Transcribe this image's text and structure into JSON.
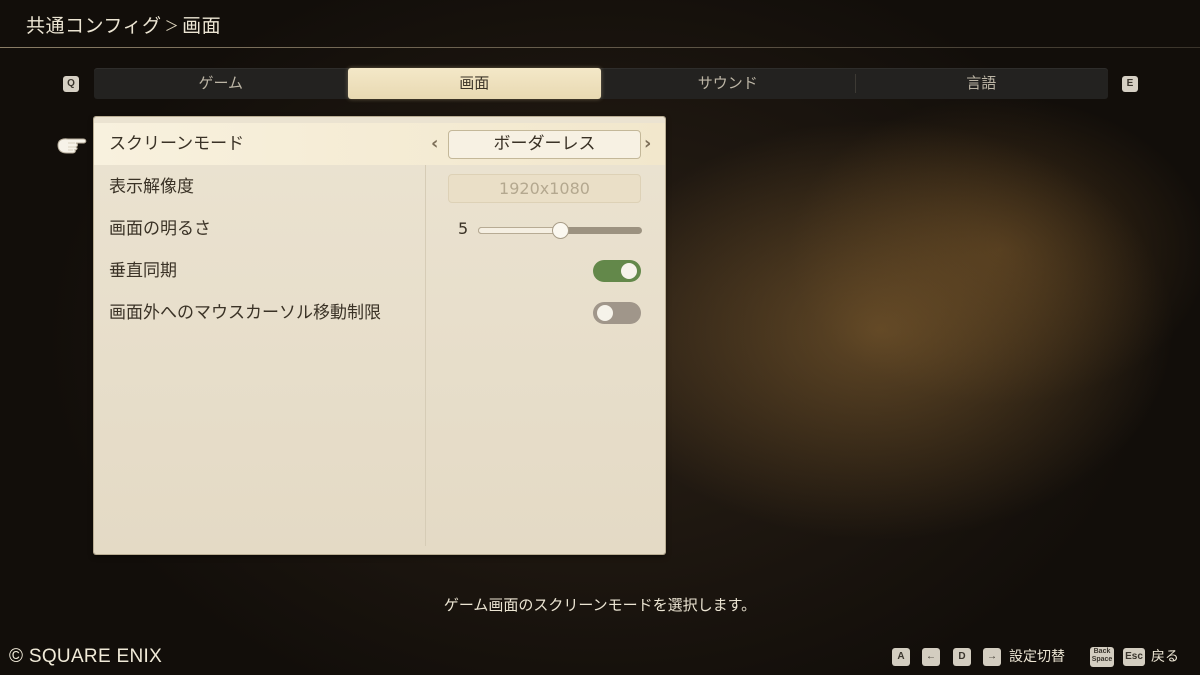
{
  "header": {
    "breadcrumb_root": "共通コンフィグ",
    "breadcrumb_separator": "＞",
    "breadcrumb_current": "画面"
  },
  "tabs": {
    "prev_key": "Q",
    "next_key": "E",
    "items": [
      {
        "label": "ゲーム",
        "active": false
      },
      {
        "label": "画面",
        "active": true
      },
      {
        "label": "サウンド",
        "active": false
      },
      {
        "label": "言語",
        "active": false
      }
    ]
  },
  "settings": {
    "screen_mode": {
      "label": "スクリーンモード",
      "value": "ボーダーレス",
      "left_arrow": "‹",
      "right_arrow": "›"
    },
    "resolution": {
      "label": "表示解像度",
      "value": "1920x1080",
      "disabled": true
    },
    "brightness": {
      "label": "画面の明るさ",
      "value": "5",
      "level_fraction": 0.5
    },
    "vsync": {
      "label": "垂直同期",
      "enabled": true
    },
    "mouse_cursor_limit": {
      "label": "画面外へのマウスカーソル移動制限",
      "enabled": false
    }
  },
  "help_text": "ゲーム画面のスクリーンモードを選択します。",
  "copyright": "© SQUARE ENIX",
  "footer": {
    "key_a": "A",
    "key_left": "←",
    "key_d": "D",
    "key_right": "→",
    "switch_label": "設定切替",
    "key_backspace": "Back Space",
    "key_esc": "Esc",
    "back_label": "戻る"
  },
  "colors": {
    "panel": "#e8dfcb",
    "tab_active": "#efe2bf",
    "toggle_on": "#63884a",
    "toggle_off": "#a0968a"
  },
  "icons": {
    "pointer": "pointing-hand-icon"
  }
}
